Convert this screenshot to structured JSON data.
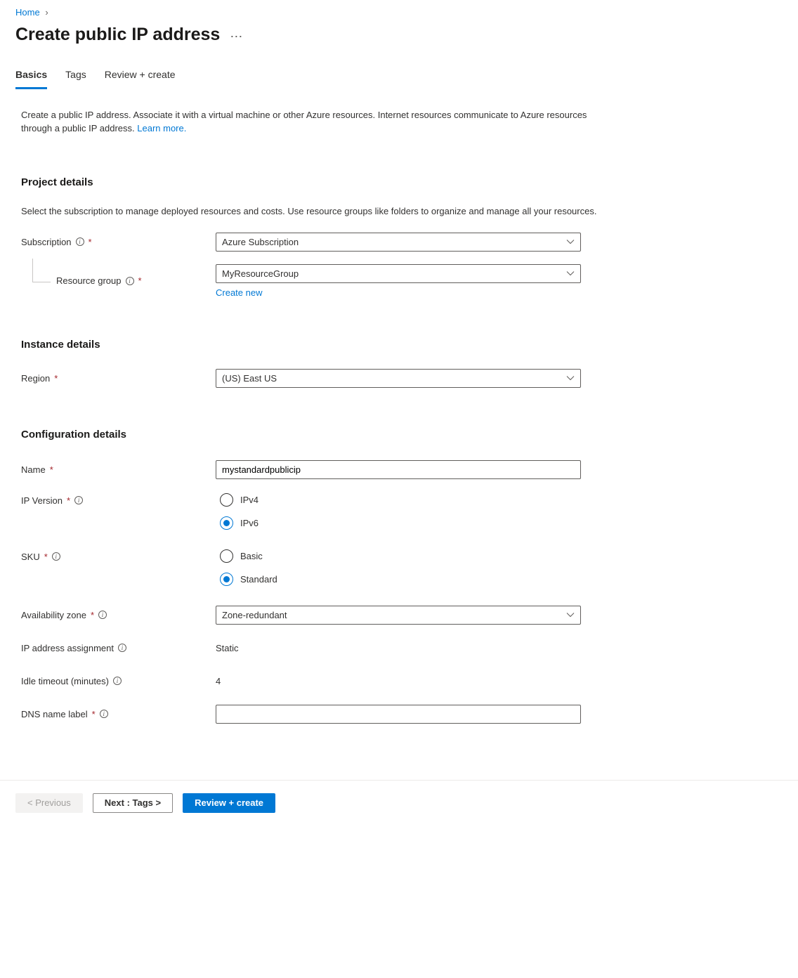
{
  "breadcrumb": {
    "home": "Home"
  },
  "page": {
    "title": "Create public IP address"
  },
  "tabs": {
    "basics": "Basics",
    "tags": "Tags",
    "review": "Review + create"
  },
  "intro": {
    "text": "Create a public IP address. Associate it with a virtual machine or other Azure resources. Internet resources communicate to Azure resources through a public IP address. ",
    "link": "Learn more."
  },
  "project": {
    "title": "Project details",
    "desc": "Select the subscription to manage deployed resources and costs. Use resource groups like folders to organize and manage all your resources.",
    "subscription_label": "Subscription",
    "subscription_value": "Azure Subscription",
    "rg_label": "Resource group",
    "rg_value": "MyResourceGroup",
    "create_new": "Create new"
  },
  "instance": {
    "title": "Instance details",
    "region_label": "Region",
    "region_value": "(US) East US"
  },
  "config": {
    "title": "Configuration details",
    "name_label": "Name",
    "name_value": "mystandardpublicip",
    "ipversion_label": "IP Version",
    "ipv4": "IPv4",
    "ipv6": "IPv6",
    "sku_label": "SKU",
    "basic": "Basic",
    "standard": "Standard",
    "az_label": "Availability zone",
    "az_value": "Zone-redundant",
    "ipassign_label": "IP address assignment",
    "ipassign_value": "Static",
    "idle_label": "Idle timeout (minutes)",
    "idle_value": "4",
    "dns_label": "DNS name label",
    "dns_value": ""
  },
  "footer": {
    "previous": "< Previous",
    "next": "Next : Tags >",
    "review": "Review + create"
  }
}
